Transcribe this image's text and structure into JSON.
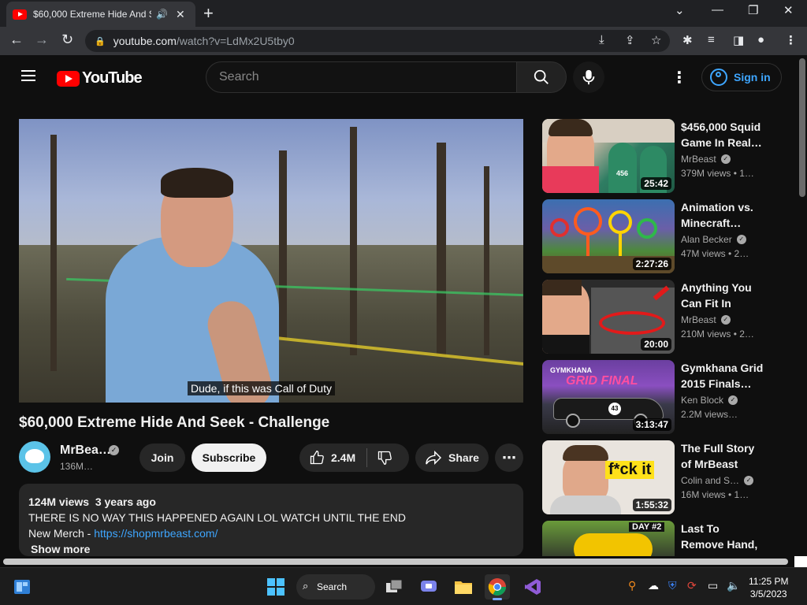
{
  "browser": {
    "tab_title": "$60,000 Extreme Hide And S",
    "audio_icon": "speaker-icon",
    "url_host": "youtube.com",
    "url_path": "/watch?v=LdMx2U5tby0"
  },
  "yt": {
    "logo_text": "YouTube",
    "search_placeholder": "Search",
    "sign_in": "Sign in"
  },
  "video": {
    "caption": "Dude, if this was Call of Duty",
    "title": "$60,000 Extreme Hide And Seek - Challenge",
    "channel": "MrBea…",
    "subscribers": "136M…",
    "join": "Join",
    "subscribe": "Subscribe",
    "likes": "2.4M",
    "share": "Share",
    "more": "⋯"
  },
  "description": {
    "views": "124M views",
    "age": "3 years ago",
    "line1": "THERE IS NO WAY THIS HAPPENED AGAIN LOL WATCH UNTIL THE END",
    "merch_label": "New Merch - ",
    "merch_link": "https://shopmrbeast.com/",
    "show_more": "Show more"
  },
  "recommendations": [
    {
      "title": "$456,000 Squid Game In Real…",
      "channel": "MrBeast",
      "meta": "379M views  • 1…",
      "duration": "25:42"
    },
    {
      "title": "Animation vs. Minecraft…",
      "channel": "Alan Becker",
      "meta": "47M views  • 2…",
      "duration": "2:27:26"
    },
    {
      "title": "Anything You Can Fit In The…",
      "channel": "MrBeast",
      "meta": "210M views  • 2…",
      "duration": "20:00"
    },
    {
      "title": "Gymkhana Grid 2015 Finals…",
      "channel": "Ken Block",
      "meta": "2.2M views…",
      "duration": "3:13:47"
    },
    {
      "title": "The Full Story of MrBeast",
      "channel": "Colin and S…",
      "meta": "16M views  • 1…",
      "duration": "1:55:32"
    },
    {
      "title": "Last To Remove Hand, Gets…",
      "channel": "",
      "meta": "",
      "duration": ""
    }
  ],
  "thumb_text": {
    "squid": "456",
    "grid_a": "GYMKHANA",
    "grid_b": "GRID FINAL",
    "car_num": "43",
    "fck": "f*ck it",
    "day2": "DAY #2"
  },
  "taskbar": {
    "search": "Search",
    "time": "11:25 PM",
    "date": "3/5/2023"
  }
}
